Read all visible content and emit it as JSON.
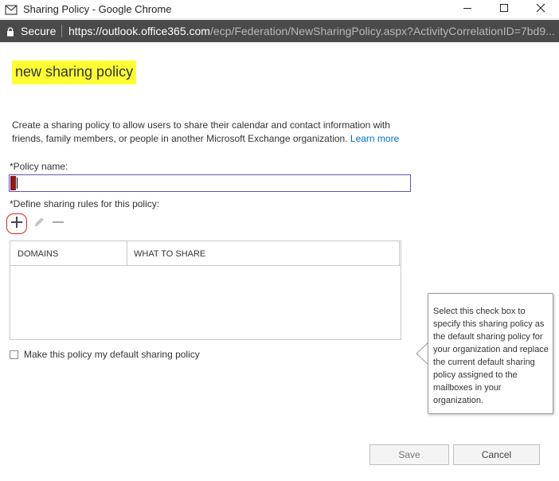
{
  "window": {
    "title": "Sharing Policy - Google Chrome",
    "icon": "outlook-icon",
    "controls": [
      "minimize-icon",
      "maximize-icon",
      "close-icon"
    ]
  },
  "addressbar": {
    "secure_label": "Secure",
    "url_scheme": "https://",
    "url_host": "outlook.office365.com",
    "url_path": "/ecp/Federation/NewSharingPolicy.aspx?ActivityCorrelationID=7bd9..."
  },
  "page": {
    "title": "new sharing policy",
    "intro": "Create a sharing policy to allow users to share their calendar and contact information with friends, family members, or people in another Microsoft Exchange organization.",
    "learn_more": "Learn more",
    "policy_name_label": "*Policy name:",
    "policy_name_value": "",
    "rules_label": "*Define sharing rules for this policy:",
    "toolbar_icons": [
      "plus-icon",
      "pencil-icon",
      "minus-icon"
    ],
    "table": {
      "columns": [
        "DOMAINS",
        "WHAT TO SHARE"
      ],
      "rows": []
    },
    "default_checkbox_checked": false,
    "default_label": "Make this policy my default sharing policy",
    "tooltip": "Select this check box to specify this sharing policy as the default sharing policy for your organization and replace the current default sharing policy assigned to the mailboxes in your organization.",
    "save_label": "Save",
    "cancel_label": "Cancel"
  },
  "colors": {
    "title_highlight": "#ffff33",
    "link": "#0072c6",
    "addressbar_bg": "#4a4a4a",
    "input_border": "#6b4fbb",
    "add_button_circle": "#e02020"
  }
}
